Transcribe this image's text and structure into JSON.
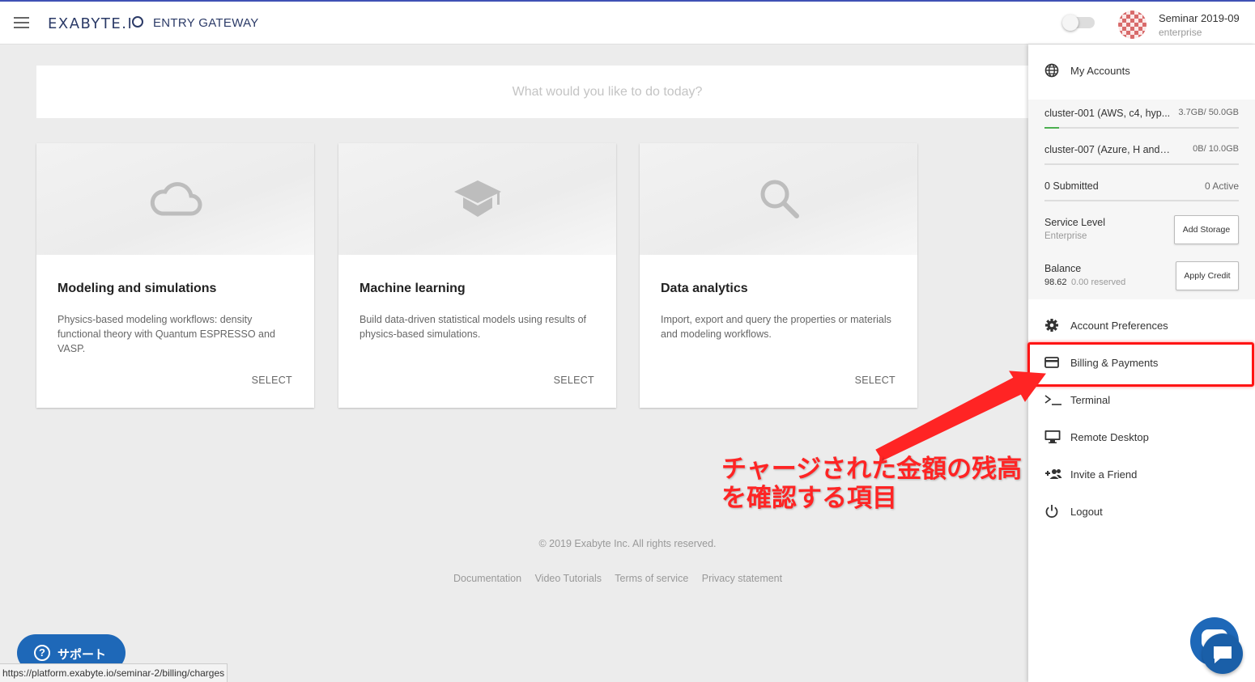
{
  "header": {
    "logo": "EXABYTE.I",
    "subtitle": "ENTRY GATEWAY",
    "user_name": "Seminar 2019-09",
    "user_plan": "enterprise"
  },
  "search": {
    "placeholder": "What would you like to do today?"
  },
  "cards": [
    {
      "title": "Modeling and simulations",
      "description": "Physics-based modeling workflows: density functional theory with Quantum ESPRESSO and VASP.",
      "action": "SELECT",
      "icon": "cloud-icon"
    },
    {
      "title": "Machine learning",
      "description": "Build data-driven statistical models using results of physics-based simulations.",
      "action": "SELECT",
      "icon": "graduation-cap-icon"
    },
    {
      "title": "Data analytics",
      "description": "Import, export and query the properties or materials and modeling workflows.",
      "action": "SELECT",
      "icon": "search-icon"
    }
  ],
  "footer": {
    "copyright": "© 2019 Exabyte Inc. All rights reserved.",
    "links": [
      "Documentation",
      "Video Tutorials",
      "Terms of service",
      "Privacy statement"
    ]
  },
  "support": {
    "label": "サポート"
  },
  "statusbar": {
    "url": "https://platform.exabyte.io/seminar-2/billing/charges"
  },
  "panel": {
    "my_accounts": "My Accounts",
    "clusters": [
      {
        "name": "cluster-001 (AWS, c4, hyp...",
        "usage": "3.7GB/ 50.0GB",
        "fill_fraction": 0.074
      },
      {
        "name": "cluster-007 (Azure, H and NC...",
        "usage": "0B/ 10.0GB",
        "fill_fraction": 0
      }
    ],
    "jobs": {
      "submitted": "0 Submitted",
      "active": "0 Active"
    },
    "service_level": {
      "label": "Service Level",
      "value": "Enterprise",
      "button": "Add Storage"
    },
    "balance": {
      "label": "Balance",
      "value": "98.62",
      "reserved": "0.00 reserved",
      "button": "Apply Credit"
    },
    "menu": [
      {
        "label": "Account Preferences",
        "icon": "gear-icon"
      },
      {
        "label": "Billing & Payments",
        "icon": "credit-card-icon"
      },
      {
        "label": "Terminal",
        "icon": "terminal-icon"
      },
      {
        "label": "Remote Desktop",
        "icon": "monitor-icon"
      },
      {
        "label": "Invite a Friend",
        "icon": "add-user-icon"
      },
      {
        "label": "Logout",
        "icon": "power-icon"
      }
    ]
  },
  "annotation": {
    "text": "チャージされた金額の残高\nを確認する項目",
    "color": "#ff2424"
  }
}
